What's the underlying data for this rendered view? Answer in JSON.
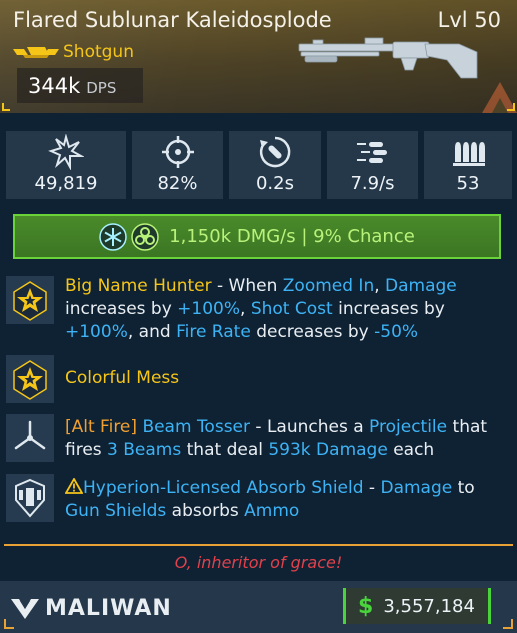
{
  "item": {
    "name": "Flared Sublunar Kaleidosplode",
    "level": "Lvl 50",
    "type": "Shotgun",
    "dps_value": "344k",
    "dps_unit": "DPS",
    "rarity_color": "#f5c518"
  },
  "stats": [
    {
      "icon": "damage-burst-icon",
      "value": "49,819"
    },
    {
      "icon": "crosshair-icon",
      "value": "82%"
    },
    {
      "icon": "reload-time-icon",
      "value": "0.2s"
    },
    {
      "icon": "fire-rate-icon",
      "value": "7.9/s"
    },
    {
      "icon": "magazine-ammo-icon",
      "value": "53"
    }
  ],
  "element": {
    "icons": [
      "cryo-icon",
      "corrosive-icon"
    ],
    "text": "1,150k DMG/s | 9% Chance",
    "color": "#6bd33a"
  },
  "perks": [
    {
      "icon": "legendary-star-icon",
      "name": "Big Name Hunter",
      "desc_1": " - When ",
      "kw_1": "Zoomed In",
      "desc_2": ", ",
      "kw_2": "Damage",
      "desc_3": " increases by ",
      "kw_3": "+100%",
      "desc_4": ", ",
      "kw_4": "Shot Cost",
      "desc_5": " increases by ",
      "kw_5": "+100%",
      "desc_6": ", and ",
      "kw_6": "Fire Rate",
      "desc_7": " decreases by ",
      "kw_7": "-50%"
    },
    {
      "icon": "legendary-star-icon",
      "name": "Colorful Mess"
    },
    {
      "icon": "alt-fire-icon",
      "tag": "[Alt Fire]",
      "kw_1": "Beam Tosser",
      "desc_1": " - Launches a ",
      "kw_2": "Projectile",
      "desc_2": " that fires ",
      "kw_3": "3 Beams",
      "desc_3": " that deal ",
      "kw_4": "593k Damage",
      "desc_4": " each"
    },
    {
      "icon": "shield-part-icon",
      "warn_icon": "warning-triangle-icon",
      "kw_1": "Hyperion-Licensed Absorb Shield",
      "desc_1": " - ",
      "kw_2": "Damage",
      "desc_2": " to ",
      "kw_3": "Gun Shields",
      "desc_3": " absorbs ",
      "kw_4": "Ammo"
    }
  ],
  "flavor_text": "O, inheritor of grace!",
  "manufacturer": "MALIWAN",
  "price": {
    "symbol": "$",
    "value": "3,557,184",
    "color": "#49d43c"
  }
}
